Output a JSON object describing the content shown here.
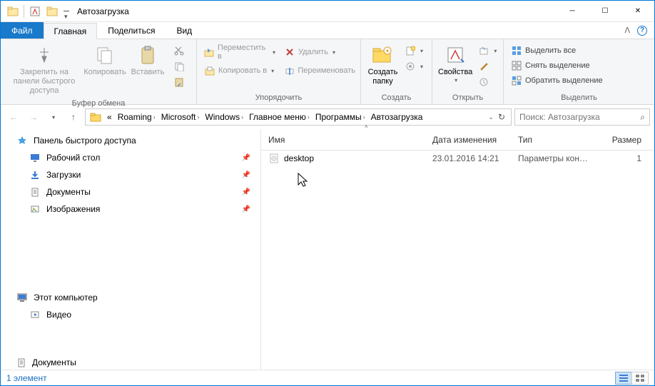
{
  "window": {
    "title": "Автозагрузка"
  },
  "tabs": {
    "file": "Файл",
    "home": "Главная",
    "share": "Поделиться",
    "view": "Вид"
  },
  "ribbon": {
    "clipboard": {
      "pin": "Закрепить на панели быстрого доступа",
      "copy": "Копировать",
      "paste": "Вставить",
      "group_label": "Буфер обмена"
    },
    "organize": {
      "move_to": "Переместить в",
      "copy_to": "Копировать в",
      "delete": "Удалить",
      "rename": "Переименовать",
      "group_label": "Упорядочить"
    },
    "new": {
      "new_folder": "Создать папку",
      "group_label": "Создать"
    },
    "open": {
      "properties": "Свойства",
      "group_label": "Открыть"
    },
    "select": {
      "select_all": "Выделить все",
      "select_none": "Снять выделение",
      "invert": "Обратить выделение",
      "group_label": "Выделить"
    }
  },
  "breadcrumb": {
    "prefix": "«",
    "segments": [
      "Roaming",
      "Microsoft",
      "Windows",
      "Главное меню",
      "Программы",
      "Автозагрузка"
    ]
  },
  "search": {
    "placeholder": "Поиск: Автозагрузка"
  },
  "navpane": {
    "quick_access": "Панель быстрого доступа",
    "desktop": "Рабочий стол",
    "downloads": "Загрузки",
    "documents": "Документы",
    "pictures": "Изображения",
    "this_pc": "Этот компьютер",
    "videos": "Видео",
    "documents2": "Документы"
  },
  "columns": {
    "name": "Имя",
    "date": "Дата изменения",
    "type": "Тип",
    "size": "Размер"
  },
  "files": [
    {
      "name": "desktop",
      "date": "23.01.2016 14:21",
      "type": "Параметры конф...",
      "size": "1"
    }
  ],
  "status": {
    "count": "1 элемент"
  }
}
